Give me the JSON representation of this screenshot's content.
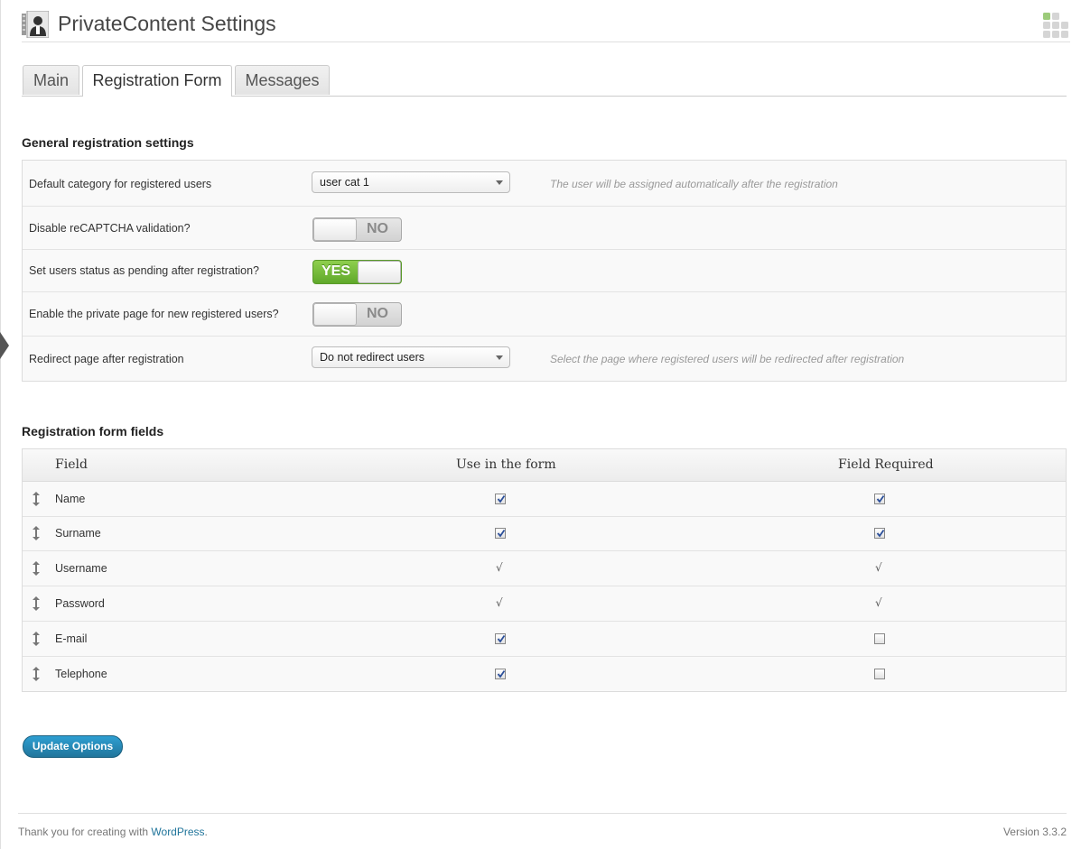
{
  "header": {
    "title": "PrivateContent Settings",
    "app_icon": "user-directory-icon",
    "screen_options_icon": "grid-icon"
  },
  "tabs": [
    {
      "label": "Main",
      "active": false
    },
    {
      "label": "Registration Form",
      "active": true
    },
    {
      "label": "Messages",
      "active": false
    }
  ],
  "general": {
    "title": "General registration settings",
    "default_category": {
      "label": "Default category for registered users",
      "value": "user cat 1",
      "hint": "The user will be assigned automatically after the registration"
    },
    "disable_recaptcha": {
      "label": "Disable reCAPTCHA validation?",
      "state": "NO"
    },
    "pending_status": {
      "label": "Set users status as pending after registration?",
      "state": "YES"
    },
    "private_page": {
      "label": "Enable the private page for new registered users?",
      "state": "NO"
    },
    "redirect": {
      "label": "Redirect page after registration",
      "value": "Do not redirect users",
      "hint": "Select the page where registered users will be redirected after registration"
    }
  },
  "fields": {
    "title": "Registration form fields",
    "columns": [
      "Field",
      "Use in the form",
      "Field Required"
    ],
    "tick_symbol": "√",
    "rows": [
      {
        "name": "Name",
        "use": "checked",
        "required": "checked"
      },
      {
        "name": "Surname",
        "use": "checked",
        "required": "checked"
      },
      {
        "name": "Username",
        "use": "fixed",
        "required": "fixed"
      },
      {
        "name": "Password",
        "use": "fixed",
        "required": "fixed"
      },
      {
        "name": "E-mail",
        "use": "checked",
        "required": "unchecked"
      },
      {
        "name": "Telephone",
        "use": "checked",
        "required": "unchecked"
      }
    ]
  },
  "update_button": "Update Options",
  "footer": {
    "thanks_prefix": "Thank you for creating with ",
    "link_text": "WordPress",
    "thanks_suffix": ".",
    "version": "Version 3.3.2"
  },
  "colors": {
    "accent": "#21759b",
    "toggle_on": "#6fb83a",
    "background": "#ffffff"
  }
}
